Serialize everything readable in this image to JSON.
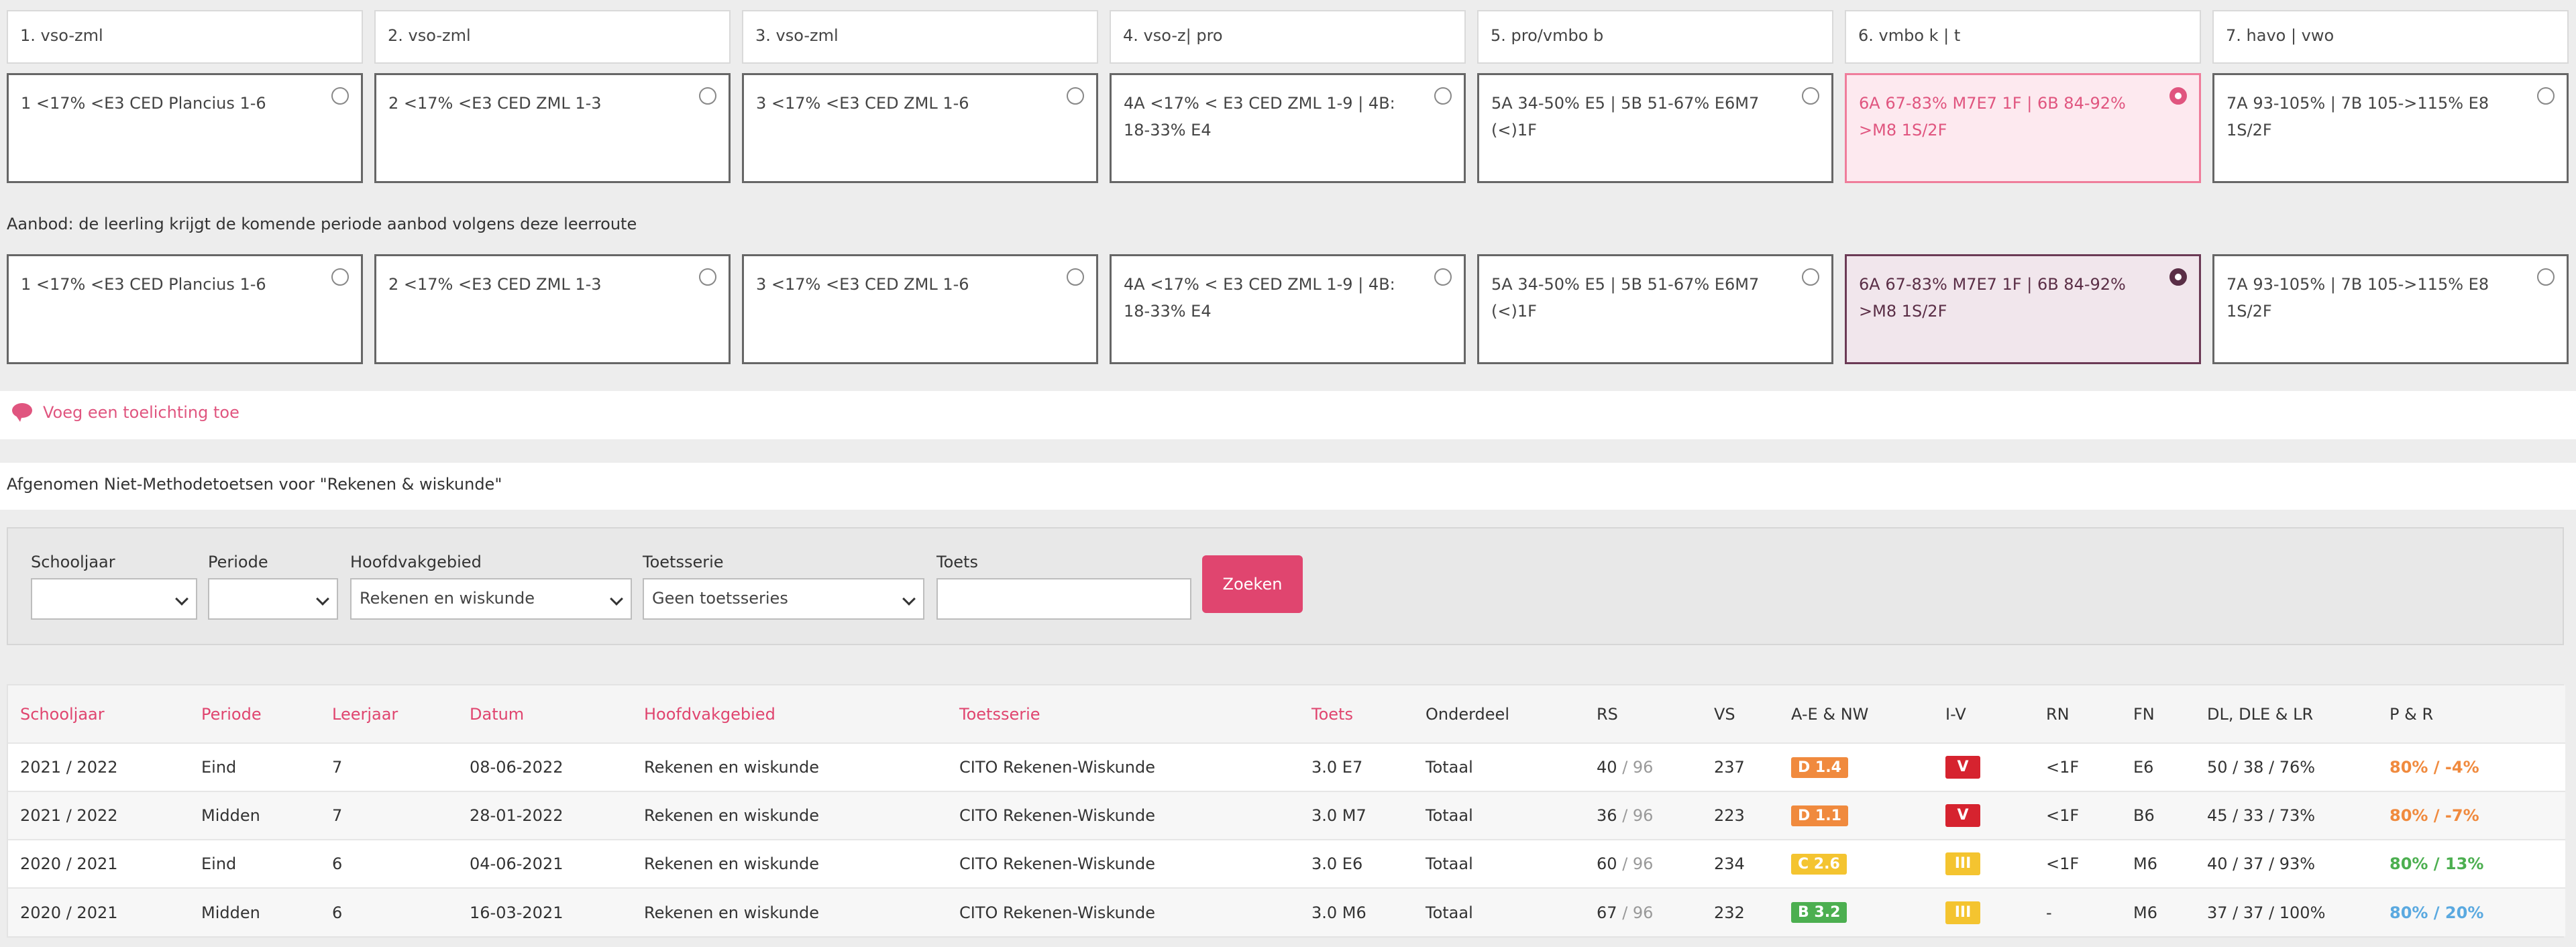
{
  "route_headers": [
    "1. vso-zml",
    "2. vso-zml",
    "3. vso-zml",
    "4. vso-z| pro",
    "5. pro/vmbo b",
    "6. vmbo k | t",
    "7. havo | vwo"
  ],
  "advice_options": [
    "1 <17% <E3 CED Plancius 1-6",
    "2 <17% <E3 CED ZML 1-3",
    "3 <17% <E3 CED ZML 1-6",
    "4A <17% < E3 CED ZML 1-9 | 4B: 18-33% E4",
    "5A 34-50% E5 | 5B 51-67% E6M7 (<)1F",
    "6A 67-83% M7E7 1F | 6B 84-92% >M8 1S/2F",
    "7A 93-105% | 7B 105->115% E8 1S/2F"
  ],
  "aanbod_label": "Aanbod: de leerling krijgt de komende periode aanbod volgens deze leerroute",
  "aanbod_options": [
    "1 <17% <E3 CED Plancius 1-6",
    "2 <17% <E3 CED ZML 1-3",
    "3 <17% <E3 CED ZML 1-6",
    "4A <17% < E3 CED ZML 1-9 | 4B: 18-33% E4",
    "5A 34-50% E5 | 5B 51-67% E6M7 (<)1F",
    "6A 67-83% M7E7 1F | 6B 84-92% >M8 1S/2F",
    "7A 93-105% | 7B 105->115% E8 1S/2F"
  ],
  "toelichting_link": "Voeg een toelichting toe",
  "afgenomen_title": "Afgenomen Niet-Methodetoetsen voor \"Rekenen & wiskunde\"",
  "filters": {
    "schooljaar_label": "Schooljaar",
    "schooljaar_value": "",
    "periode_label": "Periode",
    "periode_value": "",
    "hoofdvak_label": "Hoofdvakgebied",
    "hoofdvak_value": "Rekenen en wiskunde",
    "toetsserie_label": "Toetsserie",
    "toetsserie_value": "Geen toetsseries",
    "toets_label": "Toets",
    "toets_value": "",
    "zoeken_label": "Zoeken"
  },
  "table": {
    "headers": [
      "Schooljaar",
      "Periode",
      "Leerjaar",
      "Datum",
      "Hoofdvakgebied",
      "Toetsserie",
      "Toets",
      "Onderdeel",
      "RS",
      "VS",
      "A-E & NW",
      "I-V",
      "RN",
      "FN",
      "DL, DLE & LR",
      "P & R"
    ],
    "rows": [
      {
        "schooljaar": "2021 / 2022",
        "periode": "Eind",
        "leerjaar": "7",
        "datum": "08-06-2022",
        "hoofdvak": "Rekenen en wiskunde",
        "toetsserie": "CITO Rekenen-Wiskunde",
        "toets": "3.0 E7",
        "onderdeel": "Totaal",
        "rs": "40",
        "rs_max": "/ 96",
        "vs": "237",
        "ae": "D 1.4",
        "ae_color": "orange",
        "iv": "V",
        "iv_color": "red",
        "rn": "<1F",
        "fn": "E6",
        "dl": "50 / 38 / 76%",
        "pr": "80% / -4%",
        "pr_color": "orange"
      },
      {
        "schooljaar": "2021 / 2022",
        "periode": "Midden",
        "leerjaar": "7",
        "datum": "28-01-2022",
        "hoofdvak": "Rekenen en wiskunde",
        "toetsserie": "CITO Rekenen-Wiskunde",
        "toets": "3.0 M7",
        "onderdeel": "Totaal",
        "rs": "36",
        "rs_max": "/ 96",
        "vs": "223",
        "ae": "D 1.1",
        "ae_color": "orange",
        "iv": "V",
        "iv_color": "red",
        "rn": "<1F",
        "fn": "B6",
        "dl": "45 / 33 / 73%",
        "pr": "80% / -7%",
        "pr_color": "orange"
      },
      {
        "schooljaar": "2020 / 2021",
        "periode": "Eind",
        "leerjaar": "6",
        "datum": "04-06-2021",
        "hoofdvak": "Rekenen en wiskunde",
        "toetsserie": "CITO Rekenen-Wiskunde",
        "toets": "3.0 E6",
        "onderdeel": "Totaal",
        "rs": "60",
        "rs_max": "/ 96",
        "vs": "234",
        "ae": "C 2.6",
        "ae_color": "yellow",
        "iv": "III",
        "iv_color": "yellow",
        "rn": "<1F",
        "fn": "M6",
        "dl": "40 / 37 / 93%",
        "pr": "80% / 13%",
        "pr_color": "green"
      },
      {
        "schooljaar": "2020 / 2021",
        "periode": "Midden",
        "leerjaar": "6",
        "datum": "16-03-2021",
        "hoofdvak": "Rekenen en wiskunde",
        "toetsserie": "CITO Rekenen-Wiskunde",
        "toets": "3.0 M6",
        "onderdeel": "Totaal",
        "rs": "67",
        "rs_max": "/ 96",
        "vs": "232",
        "ae": "B 3.2",
        "ae_color": "green",
        "iv": "III",
        "iv_color": "yellow",
        "rn": "-",
        "fn": "M6",
        "dl": "37 / 37 / 100%",
        "pr": "80% / 20%",
        "pr_color": "blue"
      }
    ]
  }
}
